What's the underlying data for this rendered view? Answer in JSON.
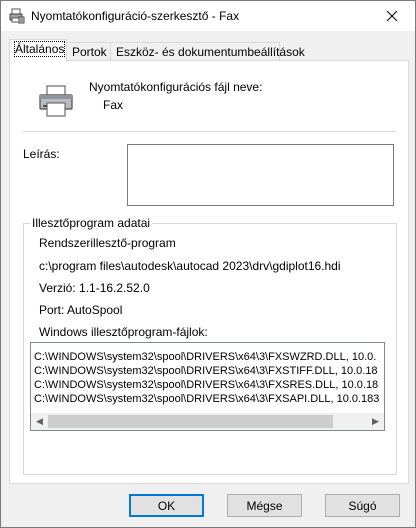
{
  "window": {
    "title": "Nyomtatókonfiguráció-szerkesztő - Fax"
  },
  "tabs": [
    {
      "label": "Általános"
    },
    {
      "label": "Portok"
    },
    {
      "label": "Eszköz- és dokumentumbeállítások"
    }
  ],
  "general": {
    "filename_label": "Nyomtatókonfigurációs fájl neve:",
    "filename_value": "Fax",
    "description_label": "Leírás:",
    "description_value": ""
  },
  "driver_info": {
    "group_title": "Illesztőprogram adatai",
    "type": "Rendszerillesztő-program",
    "path": "c:\\program files\\autodesk\\autocad 2023\\drv\\gdiplot16.hdi",
    "version": "Verzió: 1.1-16.2.52.0",
    "port": "Port: AutoSpool",
    "files_label": "Windows illesztőprogram-fájlok:",
    "files": [
      "C:\\WINDOWS\\system32\\spool\\DRIVERS\\x64\\3\\FXSWZRD.DLL, 10.0.",
      "C:\\WINDOWS\\system32\\spool\\DRIVERS\\x64\\3\\FXSTIFF.DLL, 10.0.18",
      "C:\\WINDOWS\\system32\\spool\\DRIVERS\\x64\\3\\FXSRES.DLL, 10.0.18",
      "C:\\WINDOWS\\system32\\spool\\DRIVERS\\x64\\3\\FXSAPI.DLL, 10.0.183"
    ]
  },
  "buttons": {
    "ok": "OK",
    "cancel": "Mégse",
    "help": "Súgó"
  },
  "icons": {
    "close": "close-icon",
    "title": "printer-config-icon",
    "printer": "printer-icon"
  }
}
